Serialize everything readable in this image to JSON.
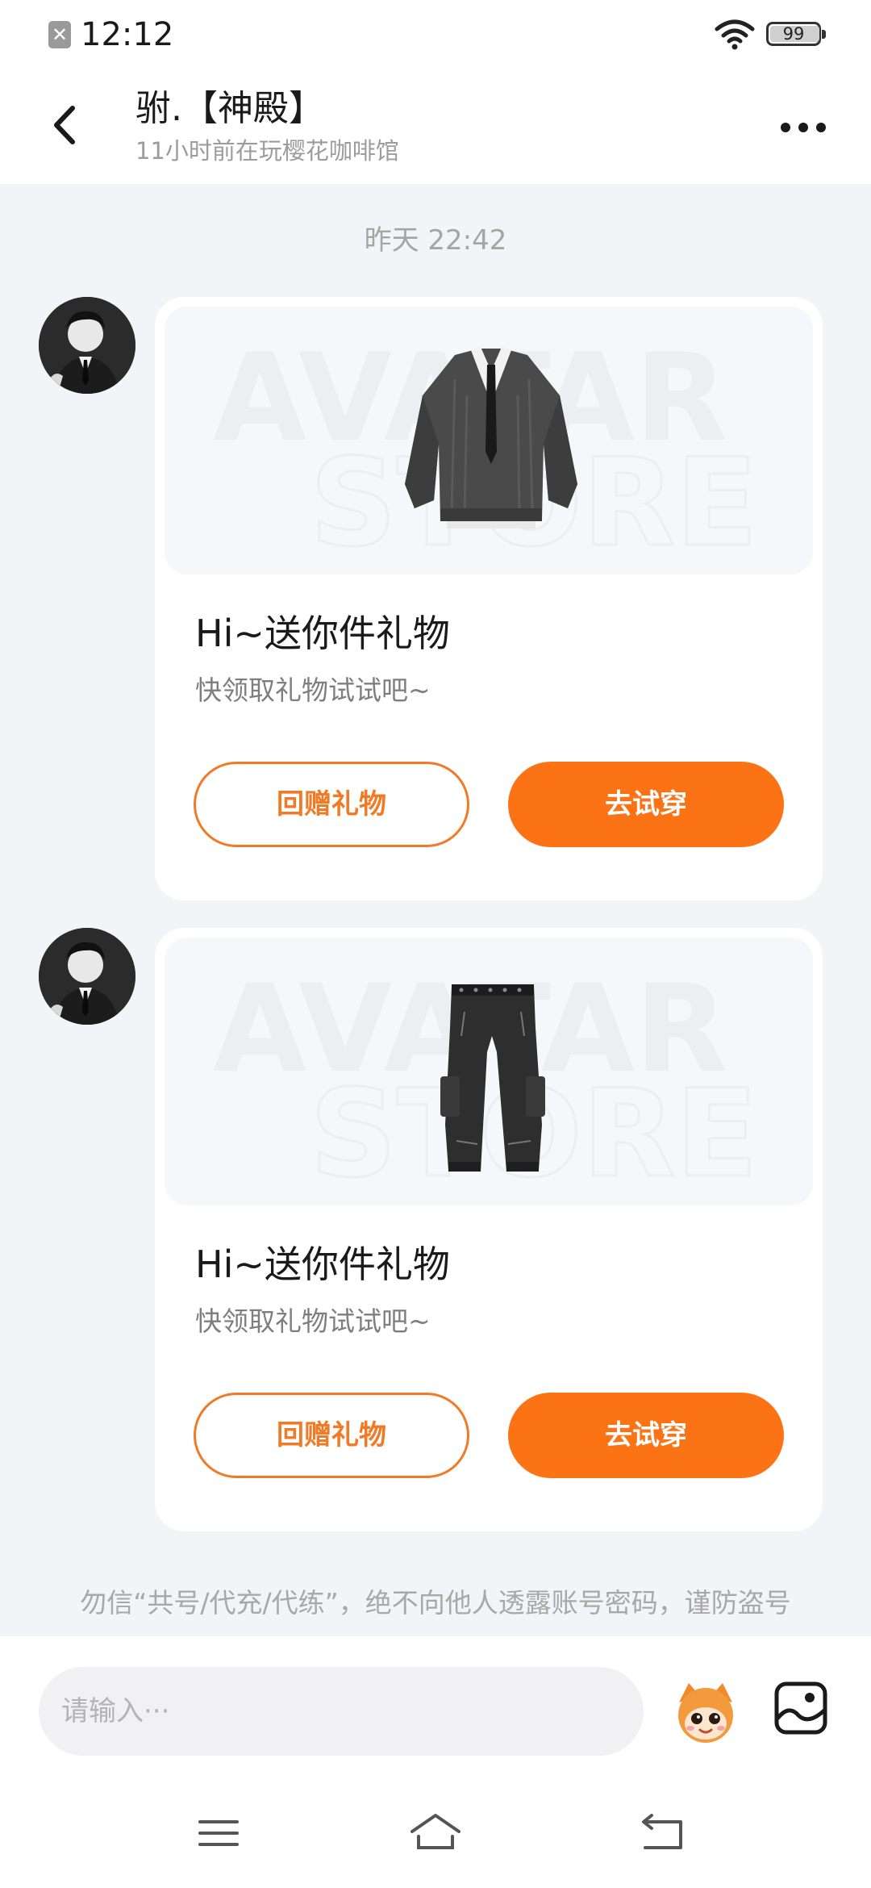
{
  "status_bar": {
    "time": "12:12",
    "battery": "99",
    "battery_fraction": 0.99,
    "notification_icon": "close-box-icon",
    "wifi_icon": "wifi-icon"
  },
  "header": {
    "title": "驸.【神殿】",
    "subtitle": "11小时前在玩樱花咖啡馆",
    "back_icon": "chevron-left-icon",
    "more_icon": "more-dots-icon"
  },
  "chat": {
    "timestamp": "昨天 22:42",
    "messages": [
      {
        "item_icon": "sweater-with-tie-icon",
        "title": "Hi~送你件礼物",
        "subtitle": "快领取礼物试试吧~",
        "return_button": "回赠礼物",
        "try_button": "去试穿"
      },
      {
        "item_icon": "cargo-pants-icon",
        "title": "Hi~送你件礼物",
        "subtitle": "快领取礼物试试吧~",
        "return_button": "回赠礼物",
        "try_button": "去试穿"
      }
    ],
    "safety_notice": "勿信“共号/代充/代练”，绝不向他人透露账号密码，谨防盗号"
  },
  "watermark_lines": [
    "AVATAR",
    "STORE"
  ],
  "input_bar": {
    "placeholder": "请输入···",
    "mascot_icon": "mascot-face-icon",
    "image_icon": "image-picker-icon"
  },
  "nav": {
    "menu_icon": "menu-icon",
    "home_icon": "home-icon",
    "back_icon": "return-icon"
  },
  "colors": {
    "accent": "#fb7314",
    "accent_outline": "#f07a25",
    "background": "#f3f4f7"
  }
}
